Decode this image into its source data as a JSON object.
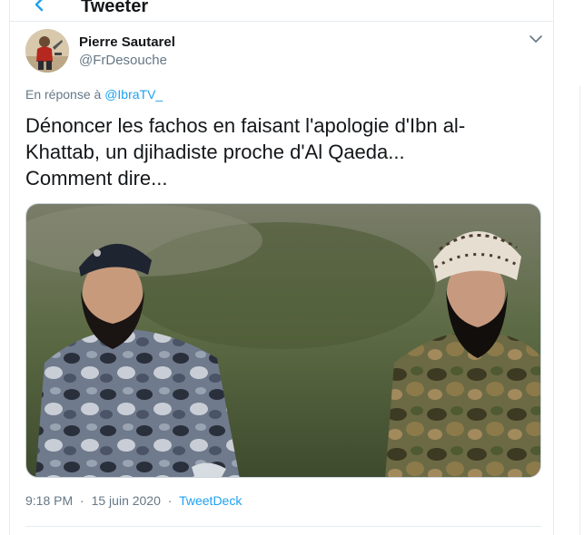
{
  "header": {
    "title": "Tweeter",
    "back_icon": "arrow-left-icon"
  },
  "tweet": {
    "author_name": "Pierre Sautarel",
    "author_handle": "@FrDesouche",
    "reply_prefix": "En réponse à",
    "reply_handle": "@IbraTV_",
    "text": "Dénoncer les fachos en faisant l'apologie d'Ibn al-\nKhattab, un djihadiste proche d'Al Qaeda...\nComment dire...",
    "time": "9:18 PM",
    "date": "15 juin 2020",
    "separator": "·",
    "source": "TweetDeck",
    "more_icon": "chevron-down-icon"
  },
  "colors": {
    "link": "#1da1f2",
    "muted": "#657786",
    "text": "#14171a",
    "border": "#e6ecf0"
  }
}
